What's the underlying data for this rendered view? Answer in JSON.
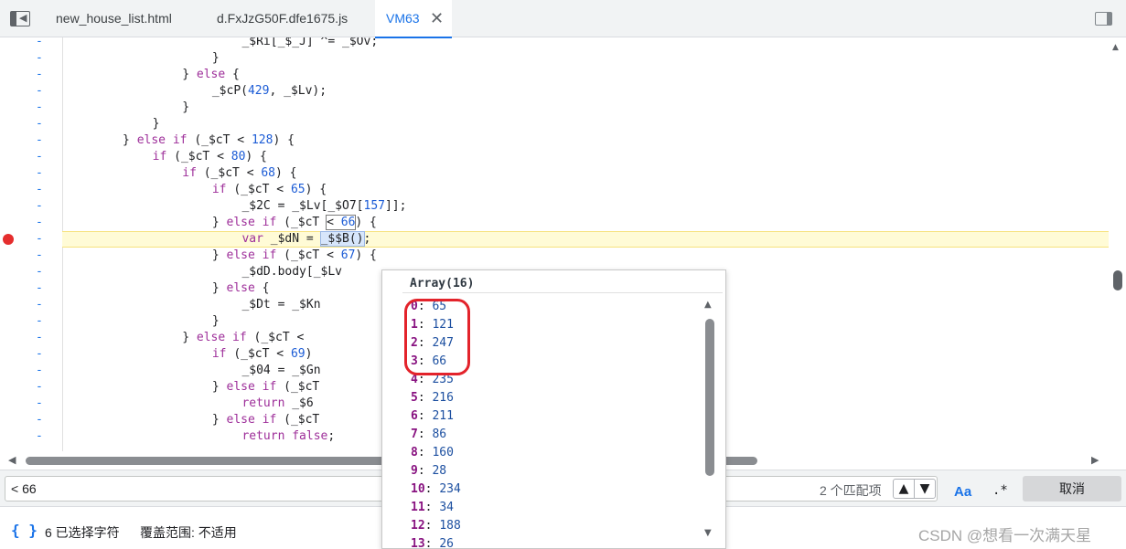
{
  "tabs": [
    {
      "label": "new_house_list.html",
      "active": false
    },
    {
      "label": "d.FxJzG50F.dfe1675.js",
      "active": false
    },
    {
      "label": "VM63",
      "active": true
    }
  ],
  "code_lines": [
    {
      "indent": 23,
      "html": "_$Ri[_$_J] ^= _$Ov;"
    },
    {
      "indent": 19,
      "html": "}"
    },
    {
      "indent": 15,
      "html": "} <span class=\"k\">else</span> {"
    },
    {
      "indent": 19,
      "html": "_$cP(<span class=\"n\">429</span>, _$Lv);"
    },
    {
      "indent": 15,
      "html": "}"
    },
    {
      "indent": 11,
      "html": "}"
    },
    {
      "indent": 7,
      "html": "} <span class=\"k\">else if</span> (_$cT &lt; <span class=\"n\">128</span>) {"
    },
    {
      "indent": 11,
      "html": "<span class=\"k\">if</span> (_$cT &lt; <span class=\"n\">80</span>) {"
    },
    {
      "indent": 15,
      "html": "<span class=\"k\">if</span> (_$cT &lt; <span class=\"n\">68</span>) {"
    },
    {
      "indent": 19,
      "html": "<span class=\"k\">if</span> (_$cT &lt; <span class=\"n\">65</span>) {"
    },
    {
      "indent": 23,
      "html": "_$2C = _$Lv[_$O7[<span class=\"n\">157</span>]];"
    },
    {
      "indent": 19,
      "html": "} <span class=\"k\">else if</span> (_$cT <span class=\"boxed\">&lt; <span class=\"n\">66</span></span>) {"
    },
    {
      "indent": 23,
      "html": "<span class=\"k\">var</span> _$dN = <span class=\"sel\">_$$B()</span>;",
      "highlight": true,
      "breakpoint": true
    },
    {
      "indent": 19,
      "html": "} <span class=\"k\">else if</span> (_$cT &lt; <span class=\"n\">67</span>) {"
    },
    {
      "indent": 23,
      "html": "_$dD.body[_$Lv"
    },
    {
      "indent": 19,
      "html": "} <span class=\"k\">else</span> {"
    },
    {
      "indent": 23,
      "html": "_$Dt = _$Kn"
    },
    {
      "indent": 19,
      "html": "}"
    },
    {
      "indent": 15,
      "html": "} <span class=\"k\">else if</span> (_$cT &lt;"
    },
    {
      "indent": 19,
      "html": "<span class=\"k\">if</span> (_$cT &lt; <span class=\"n\">69</span>)"
    },
    {
      "indent": 23,
      "html": "_$04 = _$Gn"
    },
    {
      "indent": 19,
      "html": "} <span class=\"k\">else if</span> (_$cT"
    },
    {
      "indent": 23,
      "html": "<span class=\"k\">return</span> _$6"
    },
    {
      "indent": 19,
      "html": "} <span class=\"k\">else if</span> (_$cT"
    },
    {
      "indent": 23,
      "html": "<span class=\"k\">return</span> <span class=\"k\">false</span>;"
    }
  ],
  "popover": {
    "title": "Array(16)",
    "items": [
      {
        "key": "0",
        "value": "65"
      },
      {
        "key": "1",
        "value": "121"
      },
      {
        "key": "2",
        "value": "247"
      },
      {
        "key": "3",
        "value": "66"
      },
      {
        "key": "4",
        "value": "235"
      },
      {
        "key": "5",
        "value": "216"
      },
      {
        "key": "6",
        "value": "211"
      },
      {
        "key": "7",
        "value": "86"
      },
      {
        "key": "8",
        "value": "160"
      },
      {
        "key": "9",
        "value": "28"
      },
      {
        "key": "10",
        "value": "234"
      },
      {
        "key": "11",
        "value": "34"
      },
      {
        "key": "12",
        "value": "188"
      },
      {
        "key": "13",
        "value": "26"
      }
    ]
  },
  "search": {
    "value": "< 66",
    "match_count": "2 个匹配项",
    "up_label": "▲",
    "down_label": "▼",
    "match_case_label": "Aa",
    "regex_label": ".*",
    "cancel_label": "取消"
  },
  "status": {
    "braces": "{ }",
    "selected": "6 已选择字符",
    "coverage": "覆盖范围: 不适用"
  },
  "watermark": "CSDN @想看一次满天星",
  "colors": {
    "accent": "#1a73e8",
    "highlight_line": "#fffbd6",
    "breakpoint": "#e52d2d",
    "annotation": "#e3232b"
  }
}
